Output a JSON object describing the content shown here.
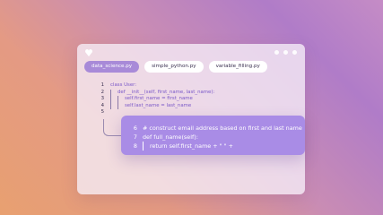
{
  "window": {
    "tabs": [
      {
        "label": "data_science.py",
        "active": true
      },
      {
        "label": "simple_python.py",
        "active": false
      },
      {
        "label": "variable_filling.py",
        "active": false
      }
    ]
  },
  "editor": {
    "lines": [
      {
        "num": "1",
        "text": "class User:"
      },
      {
        "num": "2",
        "text": "def __init__(self, first_name, last_name):"
      },
      {
        "num": "3",
        "text": "self.first_name = first_name"
      },
      {
        "num": "4",
        "text": "self.last_name = last_name"
      },
      {
        "num": "5",
        "text": ""
      }
    ]
  },
  "suggestion": {
    "lines": [
      {
        "num": "6",
        "text": "# construct email address based on first and last name"
      },
      {
        "num": "7",
        "text": "def full_name(self):"
      },
      {
        "num": "8",
        "text": "return self.first_name + \" \" +"
      }
    ]
  },
  "colors": {
    "accent": "#a98ce6",
    "code_text": "#7a58c8"
  },
  "icons": [
    "app-logo-icon"
  ]
}
